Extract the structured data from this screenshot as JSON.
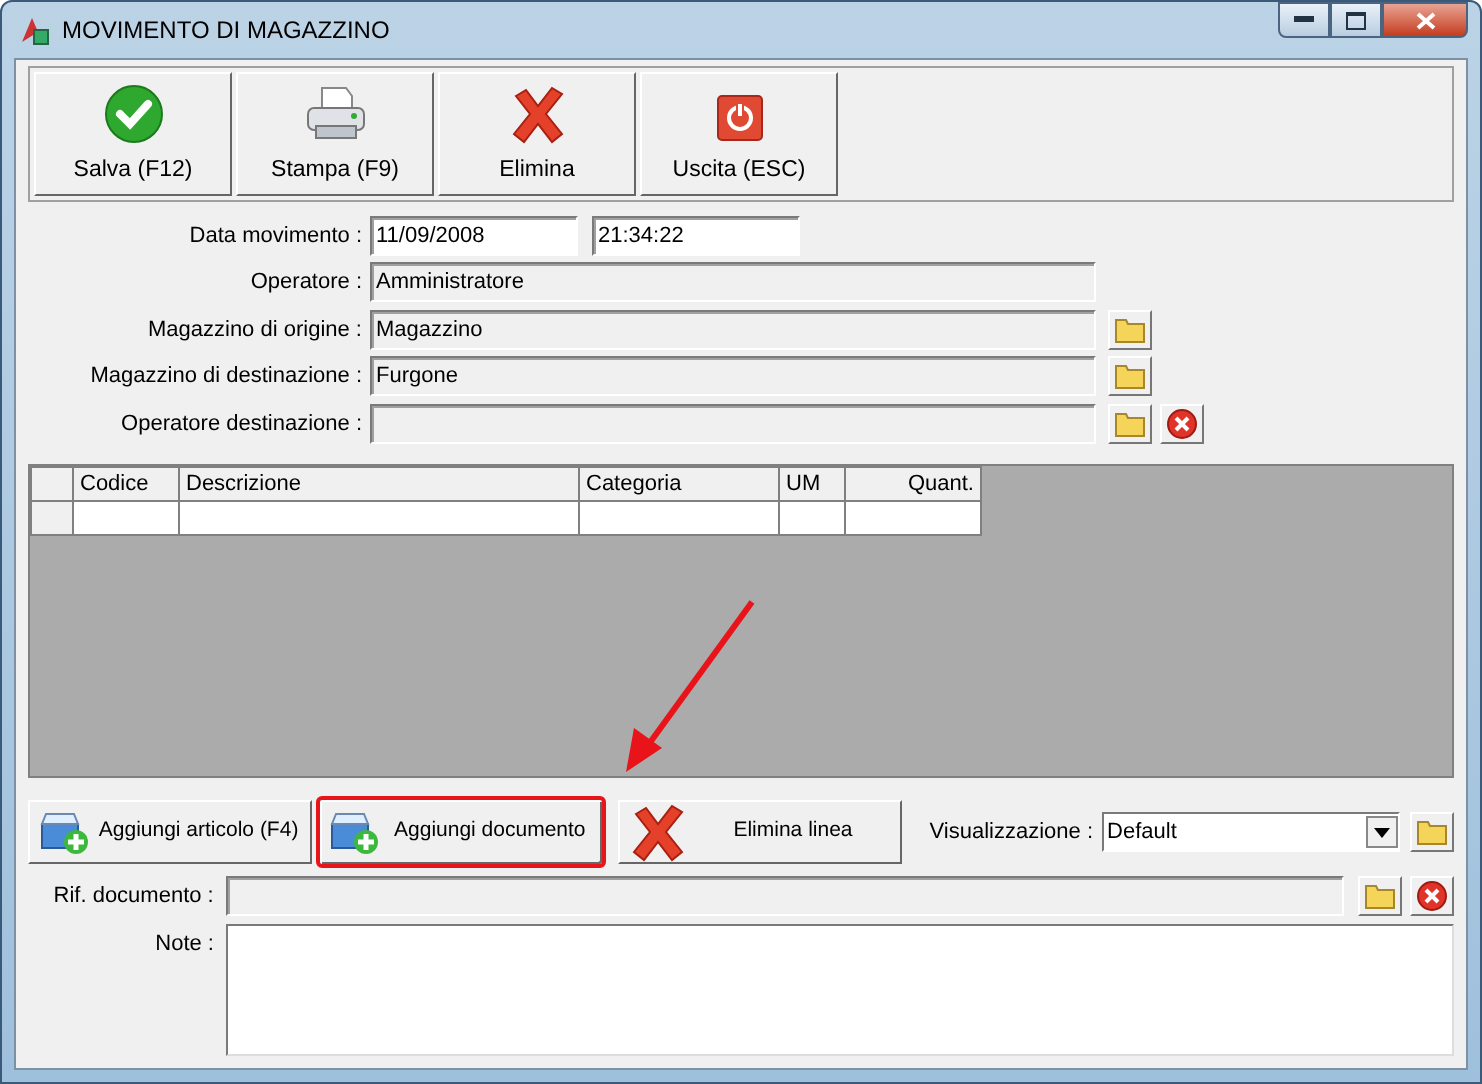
{
  "window": {
    "title": "MOVIMENTO DI MAGAZZINO"
  },
  "toolbar": [
    {
      "label": "Salva (F12)",
      "kind": "save"
    },
    {
      "label": "Stampa (F9)",
      "kind": "print"
    },
    {
      "label": "Elimina",
      "kind": "delete"
    },
    {
      "label": "Uscita (ESC)",
      "kind": "exit"
    }
  ],
  "fields": [
    {
      "label": "Data movimento :",
      "value": "11/09/2008",
      "time": "21:34:22",
      "readonly": false,
      "browse": false,
      "clear": false
    },
    {
      "label": "Operatore :",
      "value": "Amministratore",
      "readonly": true,
      "browse": false,
      "clear": false
    },
    {
      "label": "Magazzino di origine :",
      "value": "Magazzino",
      "readonly": true,
      "browse": true,
      "clear": false
    },
    {
      "label": "Magazzino di destinazione :",
      "value": "Furgone",
      "readonly": true,
      "browse": true,
      "clear": false
    },
    {
      "label": "Operatore destinazione :",
      "readonly": true,
      "browse": true,
      "clear": true
    }
  ],
  "grid": {
    "columns": [
      {
        "label": "Codice",
        "numeric": false
      },
      {
        "label": "Descrizione",
        "numeric": false
      },
      {
        "label": "Categoria",
        "numeric": false
      },
      {
        "label": "UM",
        "numeric": false
      },
      {
        "label": "Quant.",
        "numeric": true
      }
    ]
  },
  "actions": [
    {
      "label": "Aggiungi articolo (F4)",
      "kind": "add",
      "highlighted": false
    },
    {
      "label": "Aggiungi documento",
      "kind": "add",
      "highlighted": true
    },
    {
      "label": "Elimina linea",
      "kind": "delete",
      "highlighted": false
    }
  ],
  "view": {
    "label": "Visualizzazione :",
    "value": "Default"
  },
  "reference": {
    "label": "Rif. documento :",
    "readonly": true,
    "browse": true,
    "clear": true
  },
  "notes": {
    "label": "Note :"
  }
}
